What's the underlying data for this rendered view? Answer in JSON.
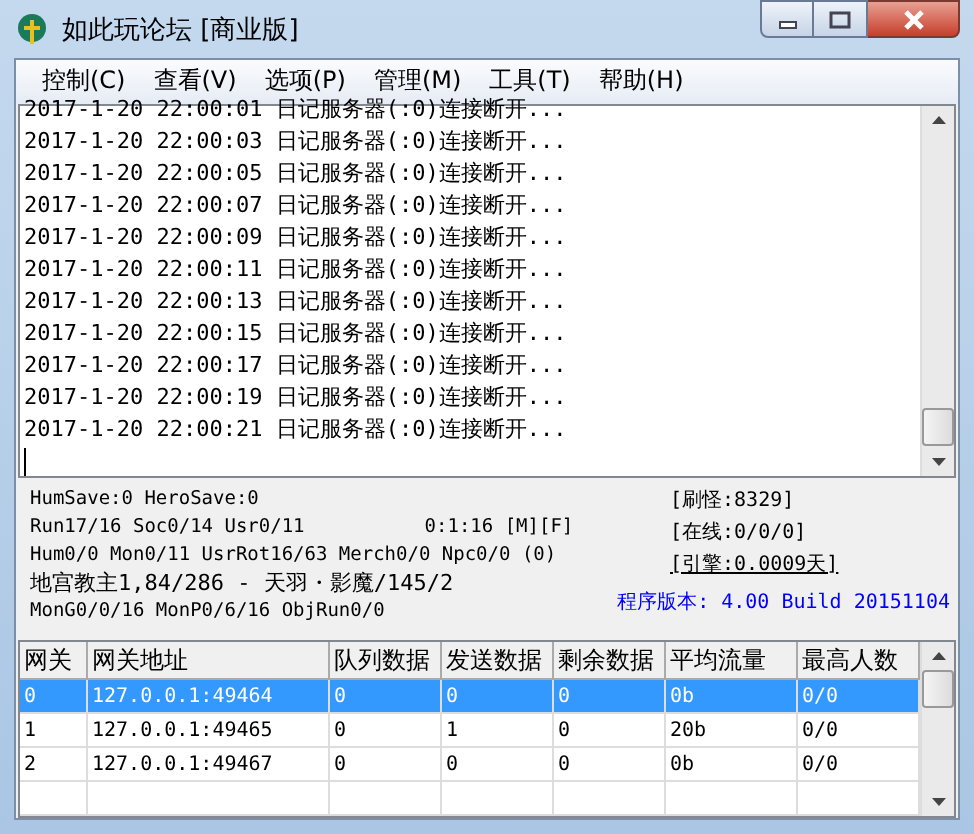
{
  "window": {
    "title": "如此玩论坛 [商业版]"
  },
  "menu": [
    "控制(C)",
    "查看(V)",
    "选项(P)",
    "管理(M)",
    "工具(T)",
    "帮助(H)"
  ],
  "log": [
    "2017-1-20 22:00:01 日记服务器(:0)连接断开...",
    "2017-1-20 22:00:03 日记服务器(:0)连接断开...",
    "2017-1-20 22:00:05 日记服务器(:0)连接断开...",
    "2017-1-20 22:00:07 日记服务器(:0)连接断开...",
    "2017-1-20 22:00:09 日记服务器(:0)连接断开...",
    "2017-1-20 22:00:11 日记服务器(:0)连接断开...",
    "2017-1-20 22:00:13 日记服务器(:0)连接断开...",
    "2017-1-20 22:00:15 日记服务器(:0)连接断开...",
    "2017-1-20 22:00:17 日记服务器(:0)连接断开...",
    "2017-1-20 22:00:19 日记服务器(:0)连接断开...",
    "2017-1-20 22:00:21 日记服务器(:0)连接断开..."
  ],
  "status": {
    "save": "HumSave:0 HeroSave:0",
    "run": "Run17/16 Soc0/14 Usr0/11",
    "uptime": "0:1:16 [M][F]",
    "counts": "Hum0/0 Mon0/11 UsrRot16/63 Merch0/0 Npc0/0 (0)",
    "boss": "地宫教主1,84/286 - 天羽・影魔/145/2",
    "mong": "MonG0/0/16 MonP0/6/16 ObjRun0/0",
    "refresh": "[刷怪:8329]",
    "online": "[在线:0/0/0]",
    "engine": "[引擎:0.0009天]",
    "version": "程序版本: 4.00 Build 20151104"
  },
  "table": {
    "columns": [
      "网关",
      "网关地址",
      "队列数据",
      "发送数据",
      "剩余数据",
      "平均流量",
      "最高人数"
    ],
    "rows": [
      {
        "cells": [
          "0",
          "127.0.0.1:49464",
          "0",
          "0",
          "0",
          "0b",
          "0/0"
        ],
        "selected": true
      },
      {
        "cells": [
          "1",
          "127.0.0.1:49465",
          "0",
          "1",
          "0",
          "20b",
          "0/0"
        ],
        "selected": false
      },
      {
        "cells": [
          "2",
          "127.0.0.1:49467",
          "0",
          "0",
          "0",
          "0b",
          "0/0"
        ],
        "selected": false
      }
    ]
  }
}
